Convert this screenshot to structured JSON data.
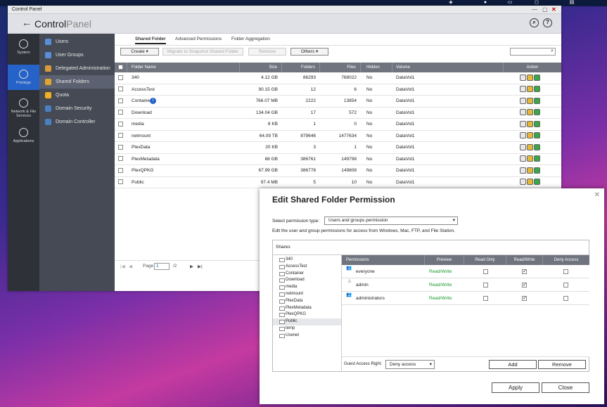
{
  "window": {
    "title": "Control Panel"
  },
  "header": {
    "title_main": "Control",
    "title_sub": "Panel"
  },
  "lnav": [
    {
      "label": "System"
    },
    {
      "label": "Privilege"
    },
    {
      "label": "Network & File Services"
    },
    {
      "label": "Applications"
    }
  ],
  "subnav": [
    {
      "label": "Users",
      "color": "#5a8fd8"
    },
    {
      "label": "User Groups",
      "color": "#5a8fd8"
    },
    {
      "label": "Delegated Administration",
      "color": "#d89a3a"
    },
    {
      "label": "Shared Folders",
      "color": "#e0a52e"
    },
    {
      "label": "Quota",
      "color": "#f0b020"
    },
    {
      "label": "Domain Security",
      "color": "#4a7fc0"
    },
    {
      "label": "Domain Controller",
      "color": "#4a7fc0"
    }
  ],
  "tabs": [
    "Shared Folder",
    "Advanced Permissions",
    "Folder Aggregation"
  ],
  "toolbar": {
    "create": "Create ▾",
    "migrate": "Migrate to Snapshot Shared Folder",
    "remove": "Remove",
    "others": "Others ▾"
  },
  "table": {
    "headers": [
      "Folder Name",
      "Size",
      "Folders",
      "Files",
      "Hidden",
      "Volume",
      "Action"
    ],
    "rows": [
      {
        "name": "340",
        "size": "4.12 GB",
        "folders": "86293",
        "files": "768022",
        "hidden": "No",
        "volume": "DataVol1"
      },
      {
        "name": "AccessTest",
        "size": "90.15 GB",
        "folders": "12",
        "files": "6",
        "hidden": "No",
        "volume": "DataVol1"
      },
      {
        "name": "Container",
        "size": "766.07 MB",
        "folders": "2222",
        "files": "13854",
        "hidden": "No",
        "volume": "DataVol1"
      },
      {
        "name": "Download",
        "size": "134.04 GB",
        "folders": "17",
        "files": "572",
        "hidden": "No",
        "volume": "DataVol1"
      },
      {
        "name": "media",
        "size": "8 KB",
        "folders": "1",
        "files": "0",
        "hidden": "No",
        "volume": "DataVol1"
      },
      {
        "name": "netmount",
        "size": "64.09 TB",
        "folders": "879646",
        "files": "1477634",
        "hidden": "No",
        "volume": "DataVol1"
      },
      {
        "name": "PlexData",
        "size": "20 KB",
        "folders": "3",
        "files": "1",
        "hidden": "No",
        "volume": "DataVol1"
      },
      {
        "name": "PlexMetadata",
        "size": "68 GB",
        "folders": "386761",
        "files": "149798",
        "hidden": "No",
        "volume": "DataVol1"
      },
      {
        "name": "PlexQPKG",
        "size": "67.99 GB",
        "folders": "386778",
        "files": "149808",
        "hidden": "No",
        "volume": "DataVol1"
      },
      {
        "name": "Public",
        "size": "97.4 MB",
        "folders": "5",
        "files": "10",
        "hidden": "No",
        "volume": "DataVol1"
      }
    ]
  },
  "pager": {
    "page_label": "Page",
    "page": "1",
    "total": "/2"
  },
  "dialog": {
    "title": "Edit Shared Folder Permission",
    "perm_type_label": "Select permission type:",
    "perm_type_value": "Users and groups permission",
    "description": "Edit the user and group permissions for access from Windows, Mac, FTP, and File Station.",
    "shares_label": "Shares",
    "tree": [
      "340",
      "AccessTest",
      "Container",
      "Download",
      "media",
      "netmount",
      "PlexData",
      "PlexMetadata",
      "PlexQPKG",
      "Public",
      "temp",
      "Usenet"
    ],
    "selected_tree": "Public",
    "perm_headers": [
      "Permissions",
      "Preview",
      "Read Only",
      "Read/Write",
      "Deny Access"
    ],
    "perms": [
      {
        "name": "everyone",
        "preview": "Read/Write",
        "ro": false,
        "rw": true,
        "deny": false
      },
      {
        "name": "admin",
        "preview": "Read/Write",
        "ro": false,
        "rw": true,
        "deny": false
      },
      {
        "name": "administrators",
        "preview": "Read/Write",
        "ro": false,
        "rw": true,
        "deny": false
      }
    ],
    "guest_label": "Guest Access Right:",
    "guest_value": "Deny access",
    "add": "Add",
    "remove": "Remove",
    "apply": "Apply",
    "close": "Close"
  }
}
